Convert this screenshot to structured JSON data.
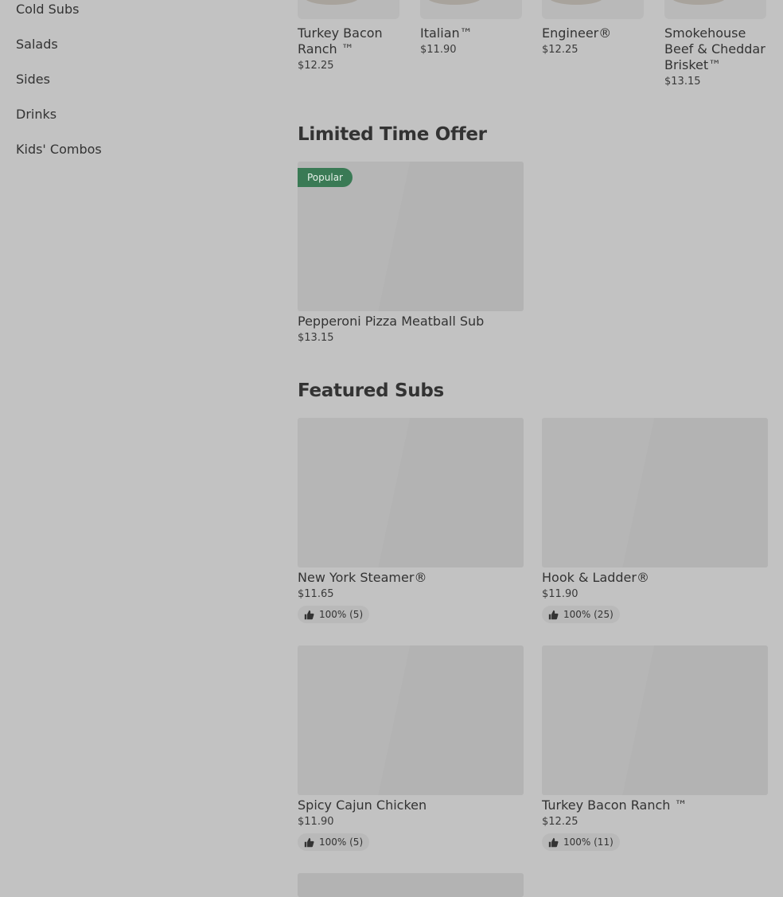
{
  "sidebar": {
    "items": [
      {
        "label": "Cold Subs"
      },
      {
        "label": "Salads"
      },
      {
        "label": "Sides"
      },
      {
        "label": "Drinks"
      },
      {
        "label": "Kids' Combos"
      }
    ]
  },
  "top_row": [
    {
      "name": "Turkey Bacon Ranch ™",
      "price": "$12.25"
    },
    {
      "name": "Italian™",
      "price": "$11.90"
    },
    {
      "name": "Engineer®",
      "price": "$12.25"
    },
    {
      "name": "Smokehouse Beef & Cheddar Brisket™",
      "price": "$13.15"
    }
  ],
  "limited_time": {
    "title": "Limited Time Offer",
    "items": [
      {
        "badge": "Popular",
        "name": "Pepperoni Pizza Meatball Sub",
        "price": "$13.15"
      }
    ]
  },
  "featured": {
    "title": "Featured Subs",
    "items": [
      {
        "name": "New York Steamer®",
        "price": "$11.65",
        "rating": "100% (5)"
      },
      {
        "name": "Hook & Ladder®",
        "price": "$11.90",
        "rating": "100% (25)"
      },
      {
        "name": "Spicy Cajun Chicken",
        "price": "$11.90",
        "rating": "100% (5)"
      },
      {
        "name": "Turkey Bacon Ranch ™",
        "price": "$12.25",
        "rating": "100% (11)"
      }
    ]
  },
  "colors": {
    "background": "#c2c2c2",
    "badge": "#3a7a55",
    "image_placeholder": "#b3b3b3"
  },
  "icons": {
    "rating": "thumbs-up-icon"
  }
}
